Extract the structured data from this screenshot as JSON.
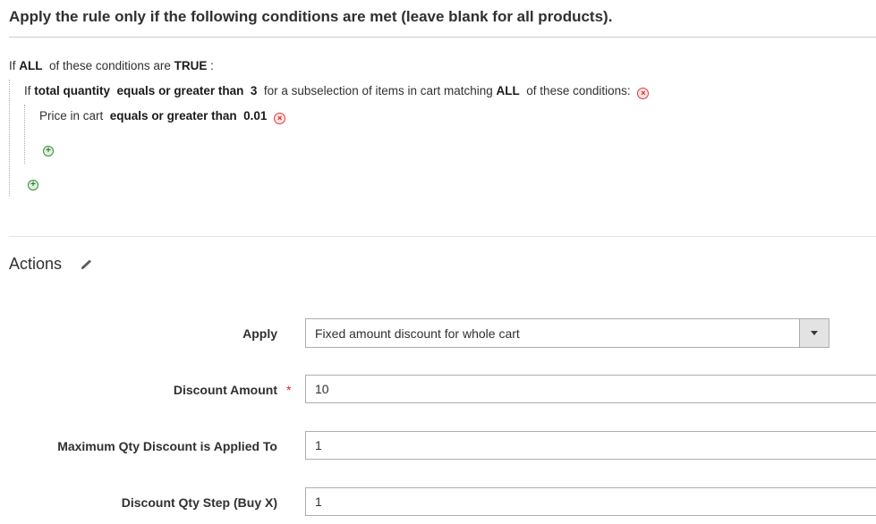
{
  "conditions": {
    "heading": "Apply the rule only if the following conditions are met (leave blank for all products).",
    "root": {
      "prefix": "If",
      "aggregator": "ALL",
      "middle": "of these conditions are",
      "value": "TRUE",
      "suffix": ":"
    },
    "subselect": {
      "prefix": "If",
      "attribute": "total quantity",
      "operator": "equals or greater than",
      "value": "3",
      "middle": "for a subselection of items in cart matching",
      "aggregator": "ALL",
      "suffix": "of these conditions:"
    },
    "item": {
      "attribute": "Price in cart",
      "operator": "equals or greater than",
      "value": "0.01"
    },
    "remove_glyph": "⊗",
    "add_glyph": "+"
  },
  "actions": {
    "title": "Actions",
    "apply": {
      "label": "Apply",
      "selected": "Fixed amount discount for whole cart"
    },
    "discount_amount": {
      "label": "Discount Amount",
      "required_mark": "*",
      "value": "10"
    },
    "max_qty": {
      "label": "Maximum Qty Discount is Applied To",
      "value": "1"
    },
    "qty_step": {
      "label": "Discount Qty Step (Buy X)",
      "value": "1"
    }
  }
}
